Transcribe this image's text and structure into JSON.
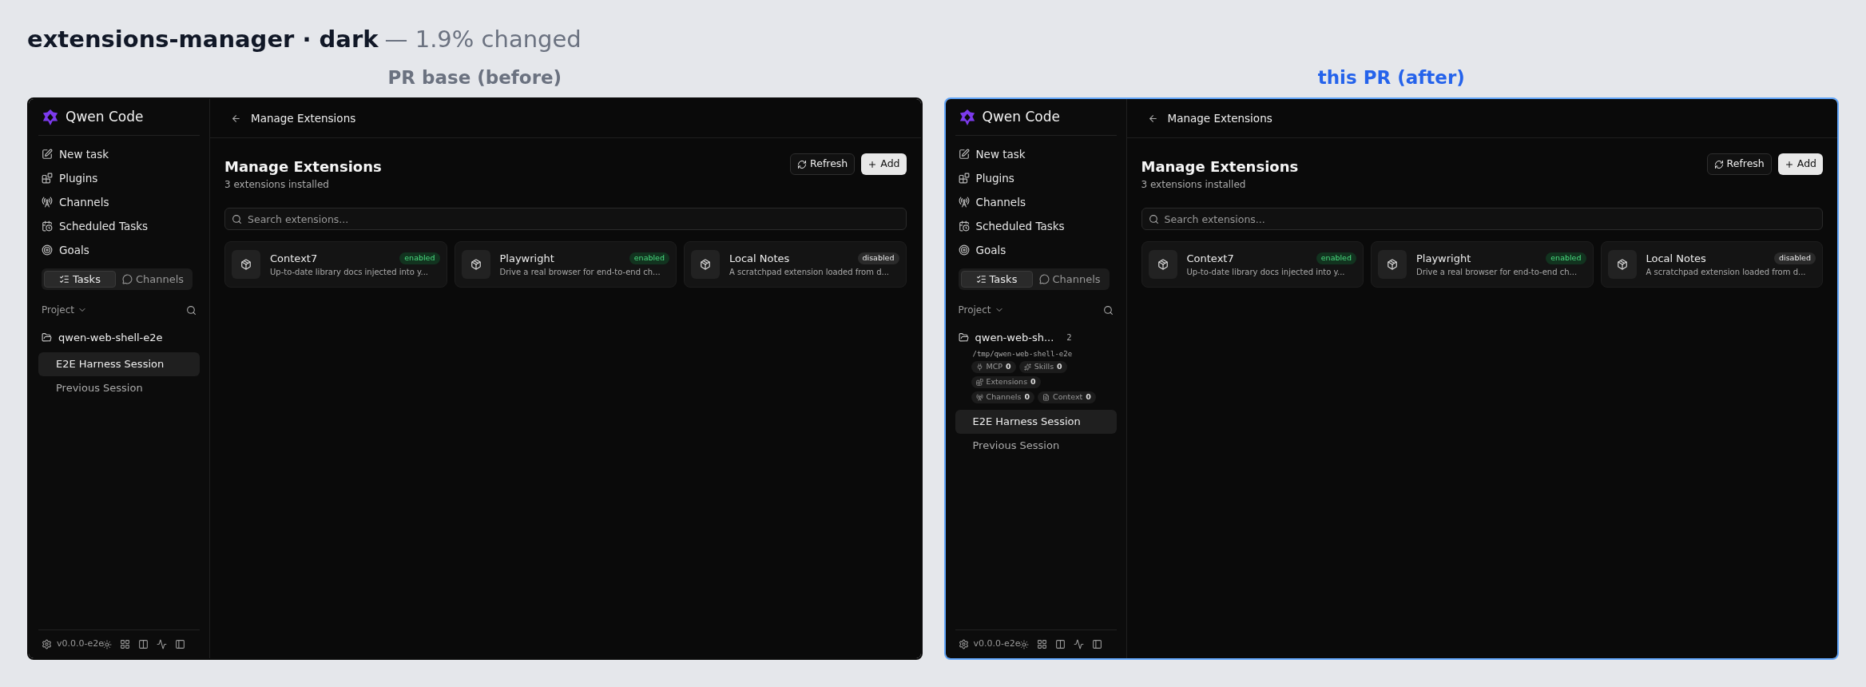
{
  "heading": {
    "title": "extensions-manager · dark",
    "summary": "— 1.9% changed"
  },
  "panels": [
    {
      "label": "PR base (before)",
      "highlighted": false,
      "app": {
        "brand": "Qwen Code",
        "nav": [
          {
            "label": "New task",
            "kind": "new"
          },
          {
            "label": "Plugins",
            "kind": "plugins"
          },
          {
            "label": "Channels",
            "kind": "channels"
          },
          {
            "label": "Scheduled Tasks",
            "kind": "scheduled"
          },
          {
            "label": "Goals",
            "kind": "goals"
          }
        ],
        "toggle": [
          {
            "label": "Tasks",
            "kind": "tasks",
            "selected": true
          },
          {
            "label": "Channels",
            "kind": "channels",
            "selected": false
          }
        ],
        "project_menu": "Project",
        "project": {
          "name": "qwen-web-shell-e2e"
        },
        "sessions": [
          {
            "label": "E2E Harness Session",
            "selected": true
          },
          {
            "label": "Previous Session",
            "selected": false
          }
        ],
        "version": "v0.0.0-e2e",
        "header": {
          "back": "Manage Extensions"
        },
        "page": {
          "title": "Manage Extensions",
          "subtitle": "3 extensions installed",
          "refresh": "Refresh",
          "add": "Add",
          "search_placeholder": "Search extensions..."
        },
        "extensions": [
          {
            "name": "Context7",
            "status": "enabled",
            "enabled": true,
            "description": "Up-to-date library docs injected into y..."
          },
          {
            "name": "Playwright",
            "status": "enabled",
            "enabled": true,
            "description": "Drive a real browser for end-to-end ch..."
          },
          {
            "name": "Local Notes",
            "status": "disabled",
            "enabled": false,
            "description": "A scratchpad extension loaded from d..."
          }
        ]
      }
    },
    {
      "label": "this PR (after)",
      "highlighted": true,
      "app": {
        "brand": "Qwen Code",
        "nav": [
          {
            "label": "New task",
            "kind": "new"
          },
          {
            "label": "Plugins",
            "kind": "plugins"
          },
          {
            "label": "Channels",
            "kind": "channels"
          },
          {
            "label": "Scheduled Tasks",
            "kind": "scheduled"
          },
          {
            "label": "Goals",
            "kind": "goals"
          }
        ],
        "toggle": [
          {
            "label": "Tasks",
            "kind": "tasks",
            "selected": true
          },
          {
            "label": "Channels",
            "kind": "channels",
            "selected": false
          }
        ],
        "project_menu": "Project",
        "project": {
          "name": "qwen-web-sh...",
          "count": "2",
          "path": "/tmp/qwen-web-shell-e2e",
          "stats": [
            {
              "kind": "mcp",
              "label": "MCP",
              "value": "0"
            },
            {
              "kind": "skills",
              "label": "Skills",
              "value": "0"
            },
            {
              "kind": "extensions",
              "label": "Extensions",
              "value": "0"
            },
            {
              "kind": "channels",
              "label": "Channels",
              "value": "0"
            },
            {
              "kind": "context",
              "label": "Context",
              "value": "0"
            }
          ]
        },
        "sessions": [
          {
            "label": "E2E Harness Session",
            "selected": true
          },
          {
            "label": "Previous Session",
            "selected": false
          }
        ],
        "version": "v0.0.0-e2e",
        "header": {
          "back": "Manage Extensions"
        },
        "page": {
          "title": "Manage Extensions",
          "subtitle": "3 extensions installed",
          "refresh": "Refresh",
          "add": "Add",
          "search_placeholder": "Search extensions..."
        },
        "extensions": [
          {
            "name": "Context7",
            "status": "enabled",
            "enabled": true,
            "description": "Up-to-date library docs injected into y..."
          },
          {
            "name": "Playwright",
            "status": "enabled",
            "enabled": true,
            "description": "Drive a real browser for end-to-end ch..."
          },
          {
            "name": "Local Notes",
            "status": "disabled",
            "enabled": false,
            "description": "A scratchpad extension loaded from d..."
          }
        ]
      }
    }
  ]
}
